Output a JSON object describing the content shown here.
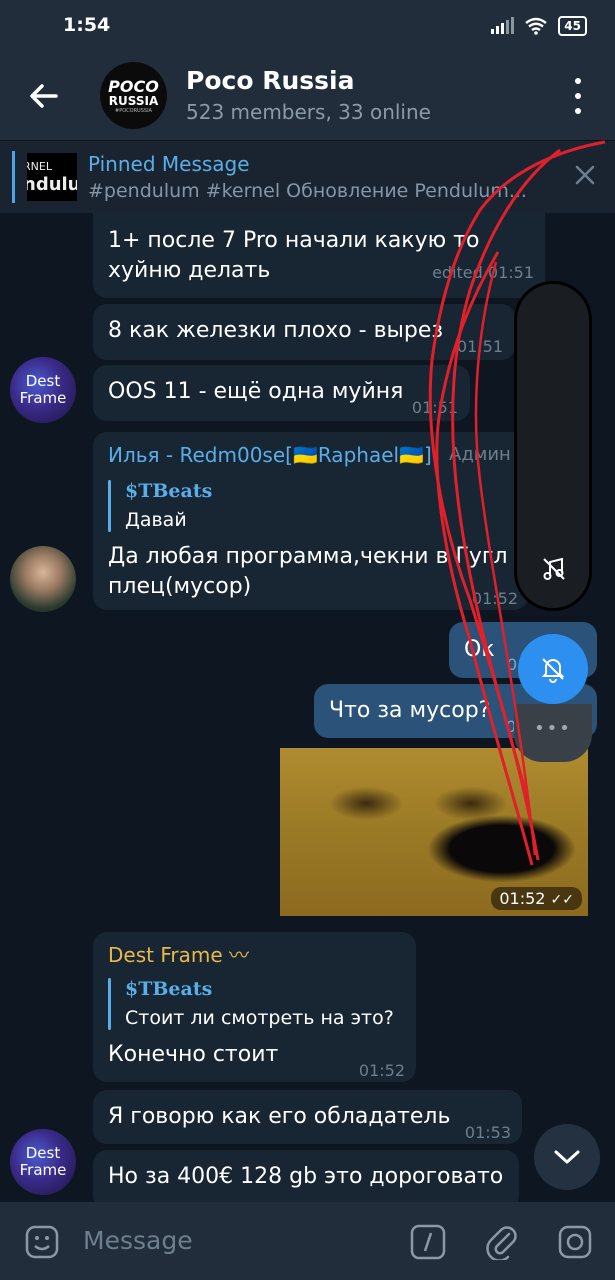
{
  "status_bar": {
    "time": "1:54",
    "battery": "45"
  },
  "header": {
    "title": "Poco Russia",
    "subtitle": "523 members, 33 online",
    "avatar_line1": "POCO",
    "avatar_line2": "RUSSIA",
    "avatar_line3": "#POCORUSSIA"
  },
  "pinned": {
    "title": "Pinned Message",
    "text": "#pendulum #kernel  Обновление Pendulum...",
    "thumb_line1": "RNEL",
    "thumb_line2": "ndulu"
  },
  "messages": [
    {
      "line1": "1+ после 7 Pro начали какую то",
      "line2": "хуйню делать",
      "time": "edited 01:51"
    },
    {
      "text": "8 как железки плохо - вырез",
      "time": "01:51"
    },
    {
      "text": "OOS 11 - ещё одна муйня",
      "time": "01:51"
    },
    {
      "sender": "Илья - Redm00se[🇺🇦Raphael🇺🇦]",
      "role": "Админ",
      "reply_name": "$TBeats",
      "reply_text": "Давай",
      "line1": "Да любая программа,чекни в Гугл",
      "line2": "плец(мусор)",
      "time": "01:52"
    },
    {
      "text": "Ок",
      "time": "0"
    },
    {
      "text": "Что за мусор?",
      "time": "0"
    },
    {
      "time": "01:52"
    },
    {
      "sender": "Dest Frame",
      "reply_name": "$TBeats",
      "reply_text": "Стоит ли смотреть на это?",
      "text": "Конечно стоит",
      "time": "01:52"
    },
    {
      "text": "Я говорю как его обладатель",
      "time": "01:53"
    },
    {
      "text": "Но за 400€ 128 gb это дороговато"
    }
  ],
  "avatars": {
    "dest_line1": "Dest",
    "dest_line2": "Frame"
  },
  "input": {
    "placeholder": "Message"
  },
  "colors": {
    "accent": "#5aaee8",
    "sender_gold": "#e8b94a",
    "bubble_in": "#182533",
    "bubble_out": "#2b5278",
    "background": "#0e1621",
    "scribble": "#e0202a"
  },
  "icons": [
    "back-arrow-icon",
    "more-vert-icon",
    "close-icon",
    "music-off-icon",
    "bell-off-icon",
    "chevron-down-icon",
    "emoji-icon",
    "bot-command-icon",
    "attach-icon",
    "camera-icon",
    "read-check-icon",
    "wifi-icon",
    "signal-icon",
    "battery-icon"
  ]
}
